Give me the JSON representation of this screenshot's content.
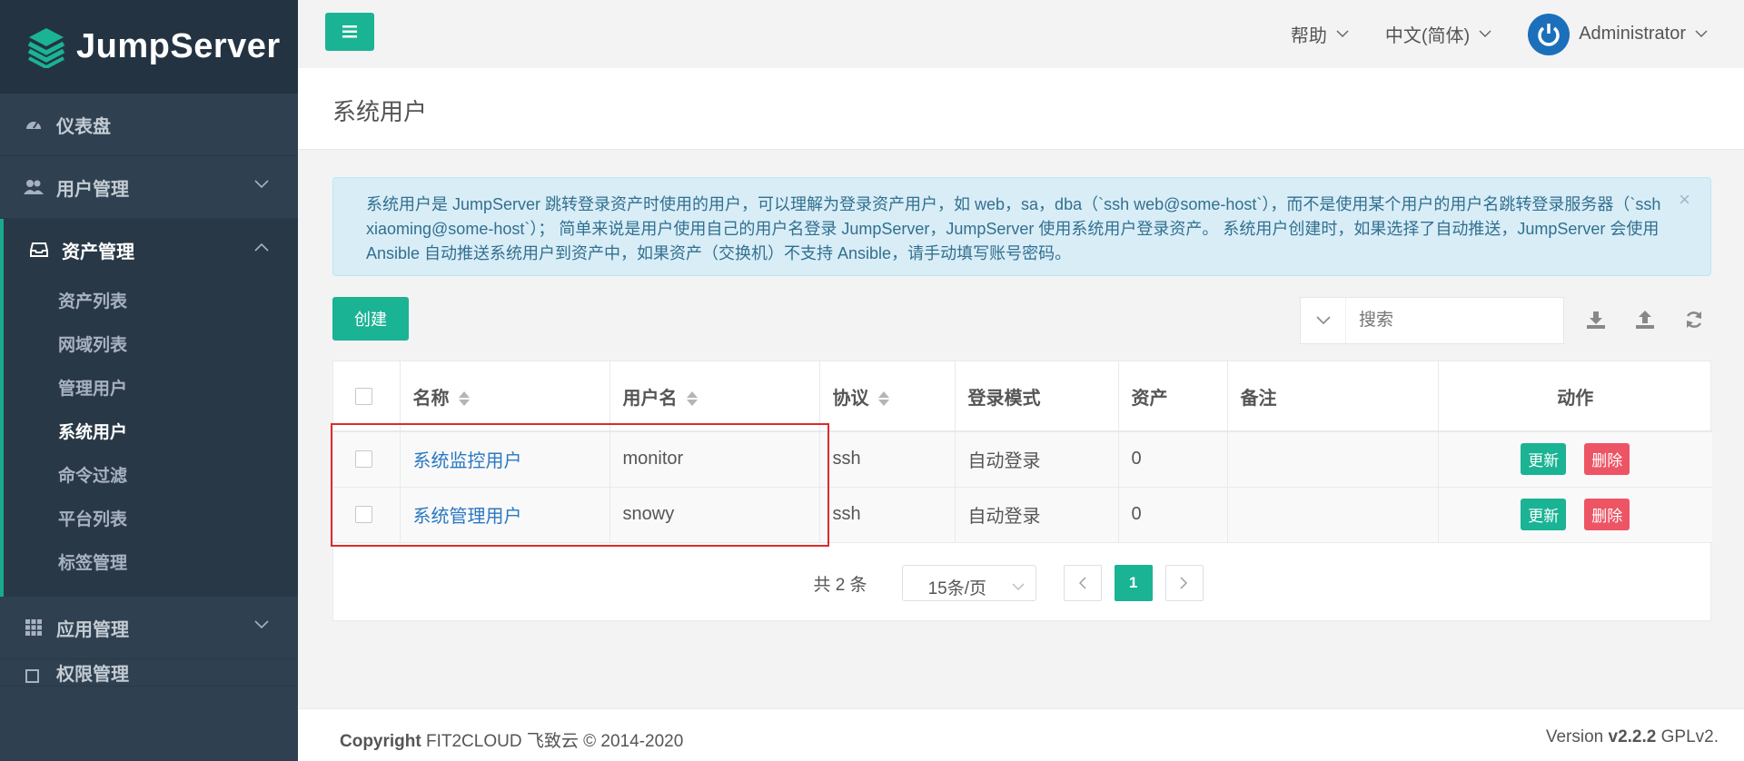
{
  "brand": {
    "name": "JumpServer"
  },
  "topbar": {
    "help": "帮助",
    "language": "中文(简体)",
    "user": "Administrator"
  },
  "sidebar": {
    "items": [
      {
        "label": "仪表盘",
        "icon": "dashboard-icon"
      },
      {
        "label": "用户管理",
        "icon": "users-icon"
      },
      {
        "label": "资产管理",
        "icon": "inbox-icon"
      },
      {
        "label": "应用管理",
        "icon": "grid-icon"
      },
      {
        "label": "权限管理",
        "icon": "edit-icon"
      }
    ],
    "assets_sub": [
      "资产列表",
      "网域列表",
      "管理用户",
      "系统用户",
      "命令过滤",
      "平台列表",
      "标签管理"
    ],
    "active_sub": "系统用户"
  },
  "page": {
    "title": "系统用户"
  },
  "alert": {
    "text": "系统用户是 JumpServer 跳转登录资产时使用的用户，可以理解为登录资产用户，如 web，sa，dba（`ssh web@some-host`），而不是使用某个用户的用户名跳转登录服务器（`ssh xiaoming@some-host`）； 简单来说是用户使用自己的用户名登录 JumpServer，JumpServer 使用系统用户登录资产。 系统用户创建时，如果选择了自动推送，JumpServer 会使用 Ansible 自动推送系统用户到资产中，如果资产（交换机）不支持 Ansible，请手动填写账号密码。",
    "close": "×"
  },
  "toolbar": {
    "create": "创建",
    "search_placeholder": "搜索"
  },
  "table": {
    "headers": [
      "名称",
      "用户名",
      "协议",
      "登录模式",
      "资产",
      "备注",
      "动作"
    ],
    "rows": [
      {
        "name": "系统监控用户",
        "username": "monitor",
        "protocol": "ssh",
        "mode": "自动登录",
        "assets": "0",
        "comment": ""
      },
      {
        "name": "系统管理用户",
        "username": "snowy",
        "protocol": "ssh",
        "mode": "自动登录",
        "assets": "0",
        "comment": ""
      }
    ],
    "update_label": "更新",
    "delete_label": "删除"
  },
  "pagination": {
    "total": "共 2 条",
    "page_size": "15条/页",
    "current": "1"
  },
  "footer": {
    "copyright_label": "Copyright",
    "copyright_text": "FIT2CLOUD 飞致云 © 2014-2020",
    "version_label": "Version",
    "version": "v2.2.2",
    "license": "GPLv2."
  },
  "colors": {
    "accent": "#1ab394",
    "danger": "#ed5565",
    "sidebar": "#2f4050",
    "alert_bg": "#d9edf7",
    "highlight": "#e02a2a"
  }
}
